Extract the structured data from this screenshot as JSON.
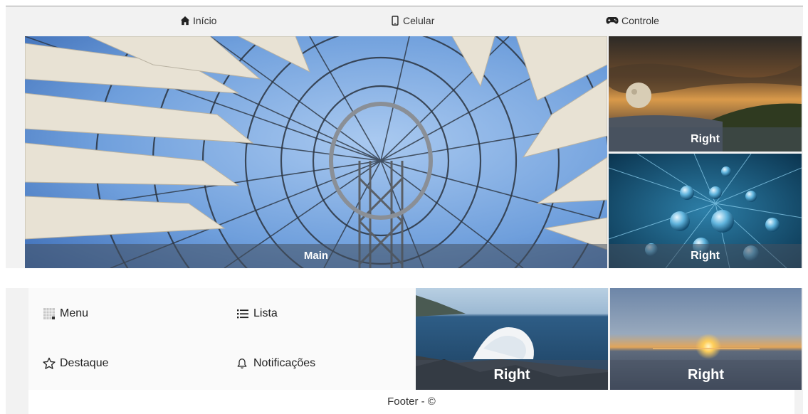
{
  "nav": {
    "items": [
      {
        "label": "Início",
        "icon": "home-icon"
      },
      {
        "label": "Celular",
        "icon": "mobile-icon"
      },
      {
        "label": "Controle",
        "icon": "gamepad-icon"
      }
    ]
  },
  "top_grid": {
    "main_caption": "Main",
    "right_captions": [
      "Right",
      "Right"
    ]
  },
  "menu": {
    "items": [
      {
        "label": "Menu",
        "icon": "grid-icon"
      },
      {
        "label": "Lista",
        "icon": "list-icon"
      },
      {
        "label": "Destaque",
        "icon": "star-icon"
      },
      {
        "label": "Notificações",
        "icon": "bell-icon"
      }
    ]
  },
  "bottom_grid": {
    "captions": [
      "Right",
      "Right"
    ]
  },
  "footer": {
    "text": "Footer - ©"
  }
}
